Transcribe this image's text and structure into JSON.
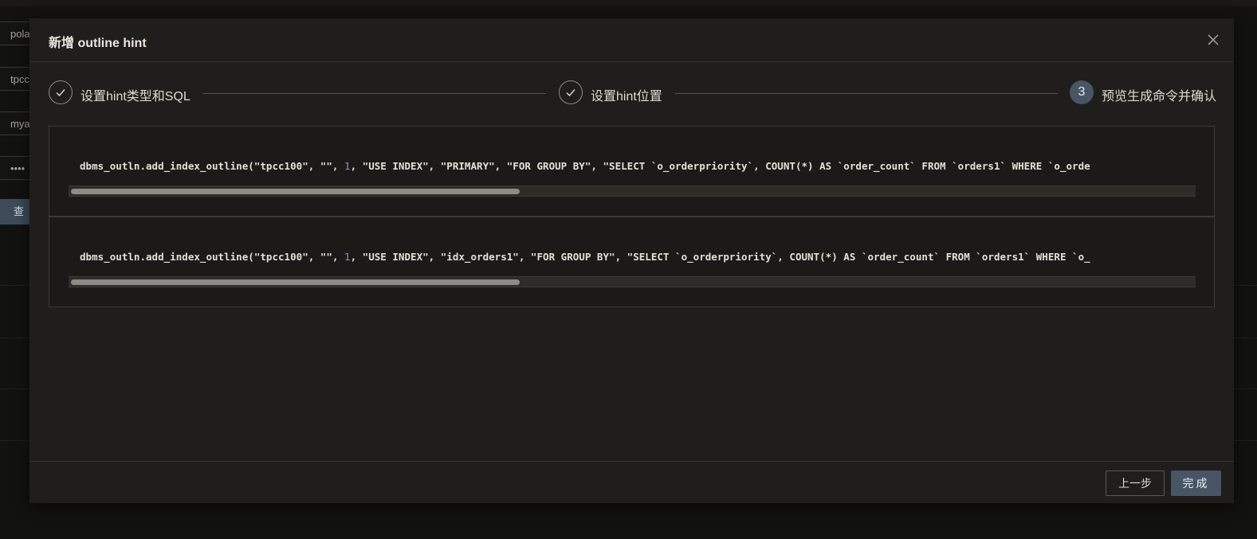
{
  "background": {
    "inputs": [
      "pola",
      "tpcc",
      "mya",
      "••••"
    ],
    "search_button": "查"
  },
  "modal": {
    "title": "新增 outline hint",
    "steps": [
      {
        "label": "设置hint类型和SQL",
        "state": "done"
      },
      {
        "label": "设置hint位置",
        "state": "done"
      },
      {
        "number": "3",
        "label": "预览生成命令并确认",
        "state": "active"
      }
    ],
    "code_blocks": [
      {
        "pre": "dbms_outln.add_index_outline(\"tpcc100\", \"\", ",
        "num": "1",
        "post": ", \"USE INDEX\", \"PRIMARY\", \"FOR GROUP BY\", \"SELECT `o_orderpriority`, COUNT(*) AS `order_count` FROM `orders1` WHERE `o_orde",
        "scroll_thumb_fraction": 0.4
      },
      {
        "pre": "dbms_outln.add_index_outline(\"tpcc100\", \"\", ",
        "num": "1",
        "post": ", \"USE INDEX\", \"idx_orders1\", \"FOR GROUP BY\", \"SELECT `o_orderpriority`, COUNT(*) AS `order_count` FROM `orders1` WHERE `o_",
        "scroll_thumb_fraction": 0.4
      }
    ],
    "footer": {
      "prev_label": "上一步",
      "done_label": "完成"
    }
  },
  "colors": {
    "modal_bg": "#1f1e1c",
    "primary": "#475565",
    "number_literal": "#8e8fd0"
  }
}
